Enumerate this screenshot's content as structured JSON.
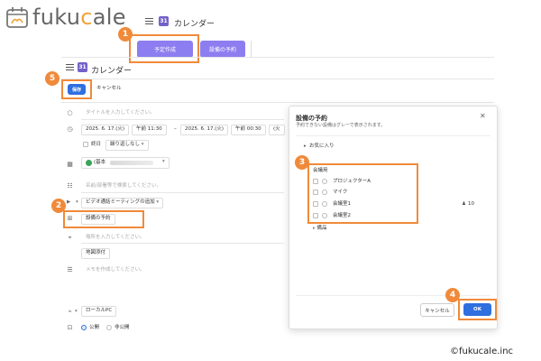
{
  "brand": {
    "logo_text_a": "fuku",
    "logo_text_c": "c",
    "logo_text_b": "ale",
    "copyright": "©fukucale.inc"
  },
  "top": {
    "app_title": "カレンダー",
    "create_label": "予定作成",
    "facility_label": "設備の予約"
  },
  "editor": {
    "app_title": "カレンダー",
    "save_label": "保存",
    "cancel_label": "キャンセル",
    "title_placeholder": "タイトルを入力してください。",
    "start_date": "2025. 6. 17.(火)",
    "start_time": "午前 11:30",
    "end_date": "2025. 6. 17.(火)",
    "end_time": "午前 00:30",
    "end_date_short": "(火",
    "allday_label": "終日",
    "repeat_label": "繰り返しなし",
    "calendar_owner_prefix": "(基本",
    "guest_placeholder": "名前/部署等で検索してください。",
    "video_label": "ビデオ通話ミーティングの追加",
    "facility_label": "設備の予約",
    "location_placeholder": "場所を入力してください。",
    "map_label": "地図添付",
    "memo_placeholder": "メモを作成してください。",
    "attach_label": "ローカルPC",
    "visibility_public": "公開",
    "visibility_private": "非公開"
  },
  "modal": {
    "title": "設備の予約",
    "subtitle": "予約できない設備はグレーで表示されます。",
    "favorites_label": "お気に入り",
    "group_label": "会議用",
    "items": [
      {
        "label": "プロジェクターA"
      },
      {
        "label": "マイク"
      },
      {
        "label": "会議室1"
      },
      {
        "label": "会議室2"
      }
    ],
    "capacity": "10",
    "other_label": "備品",
    "cancel_label": "キャンセル",
    "ok_label": "OK"
  },
  "steps": {
    "s1": "1",
    "s2": "2",
    "s3": "3",
    "s4": "4",
    "s5": "5"
  },
  "colors": {
    "accent_orange": "#f08a3a",
    "button_purple": "#8c7ef0",
    "ok_blue": "#2f6fe0",
    "calendar_green": "#3aa35a"
  },
  "icons": [
    "calendar-logo-icon",
    "hamburger-icon",
    "app-icon",
    "clock-icon",
    "calendar-icon",
    "users-icon",
    "video-icon",
    "facility-icon",
    "location-icon",
    "memo-icon",
    "attach-icon",
    "lock-icon",
    "close-icon",
    "star-icon",
    "person-icon"
  ]
}
